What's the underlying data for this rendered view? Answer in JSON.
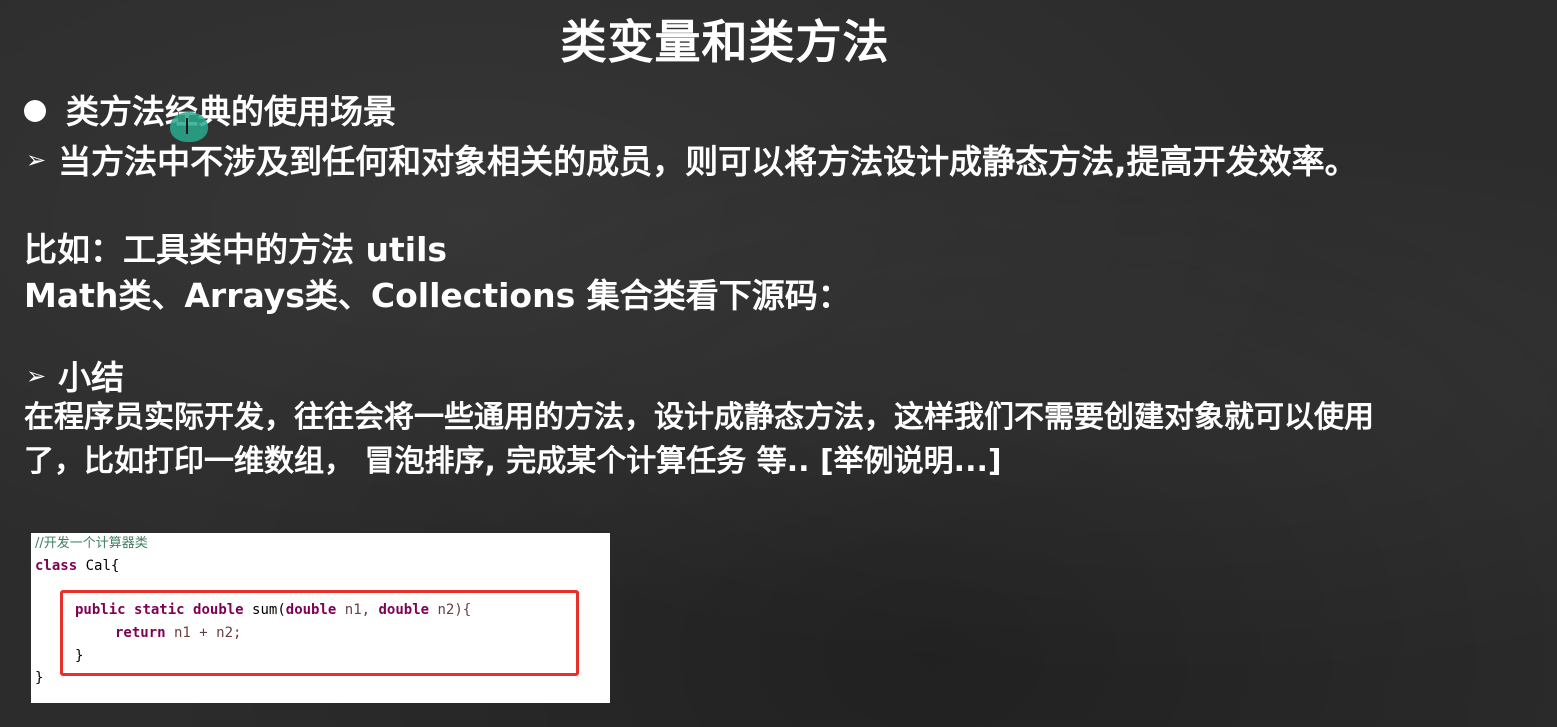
{
  "slide": {
    "title": "类变量和类方法",
    "bullet_heading": "类方法经典的使用场景",
    "point1": "当方法中不涉及到任何和对象相关的成员，则可以将方法设计成静态方法,提高开发效率。",
    "example_line1": "比如：工具类中的方法 utils",
    "example_line2": "Math类、Arrays类、Collections 集合类看下源码：",
    "summary_heading": "小结",
    "summary_line1": "在程序员实际开发，往往会将一些通用的方法，设计成静态方法，这样我们不需要创建对象就可以使用",
    "summary_line2": "了，比如打印一维数组， 冒泡排序, 完成某个计算任务 等.. [举例说明...]"
  },
  "icons": {
    "bullet": "filled-circle-bullet",
    "arrow": "arrowhead-bullet",
    "cursor": "mouse-cursor-highlight"
  },
  "code": {
    "comment": "//开发一个计算器类",
    "class_keyword": "class",
    "class_name": " Cal{",
    "method_public": "public",
    "method_static": "static",
    "method_double": "double",
    "method_sig": " sum(",
    "param1_type": "double",
    "param1_name": " n1, ",
    "param2_type": "double",
    "param2_name": " n2){",
    "return_keyword": "return",
    "return_expr": " n1 + n2;",
    "method_close": "}",
    "class_close": "}"
  },
  "colors": {
    "background": "#2c2c2c",
    "text": "#ffffff",
    "highlight_border": "#e8302a",
    "keyword": "#7f0055",
    "comment": "#3f7f5f"
  }
}
